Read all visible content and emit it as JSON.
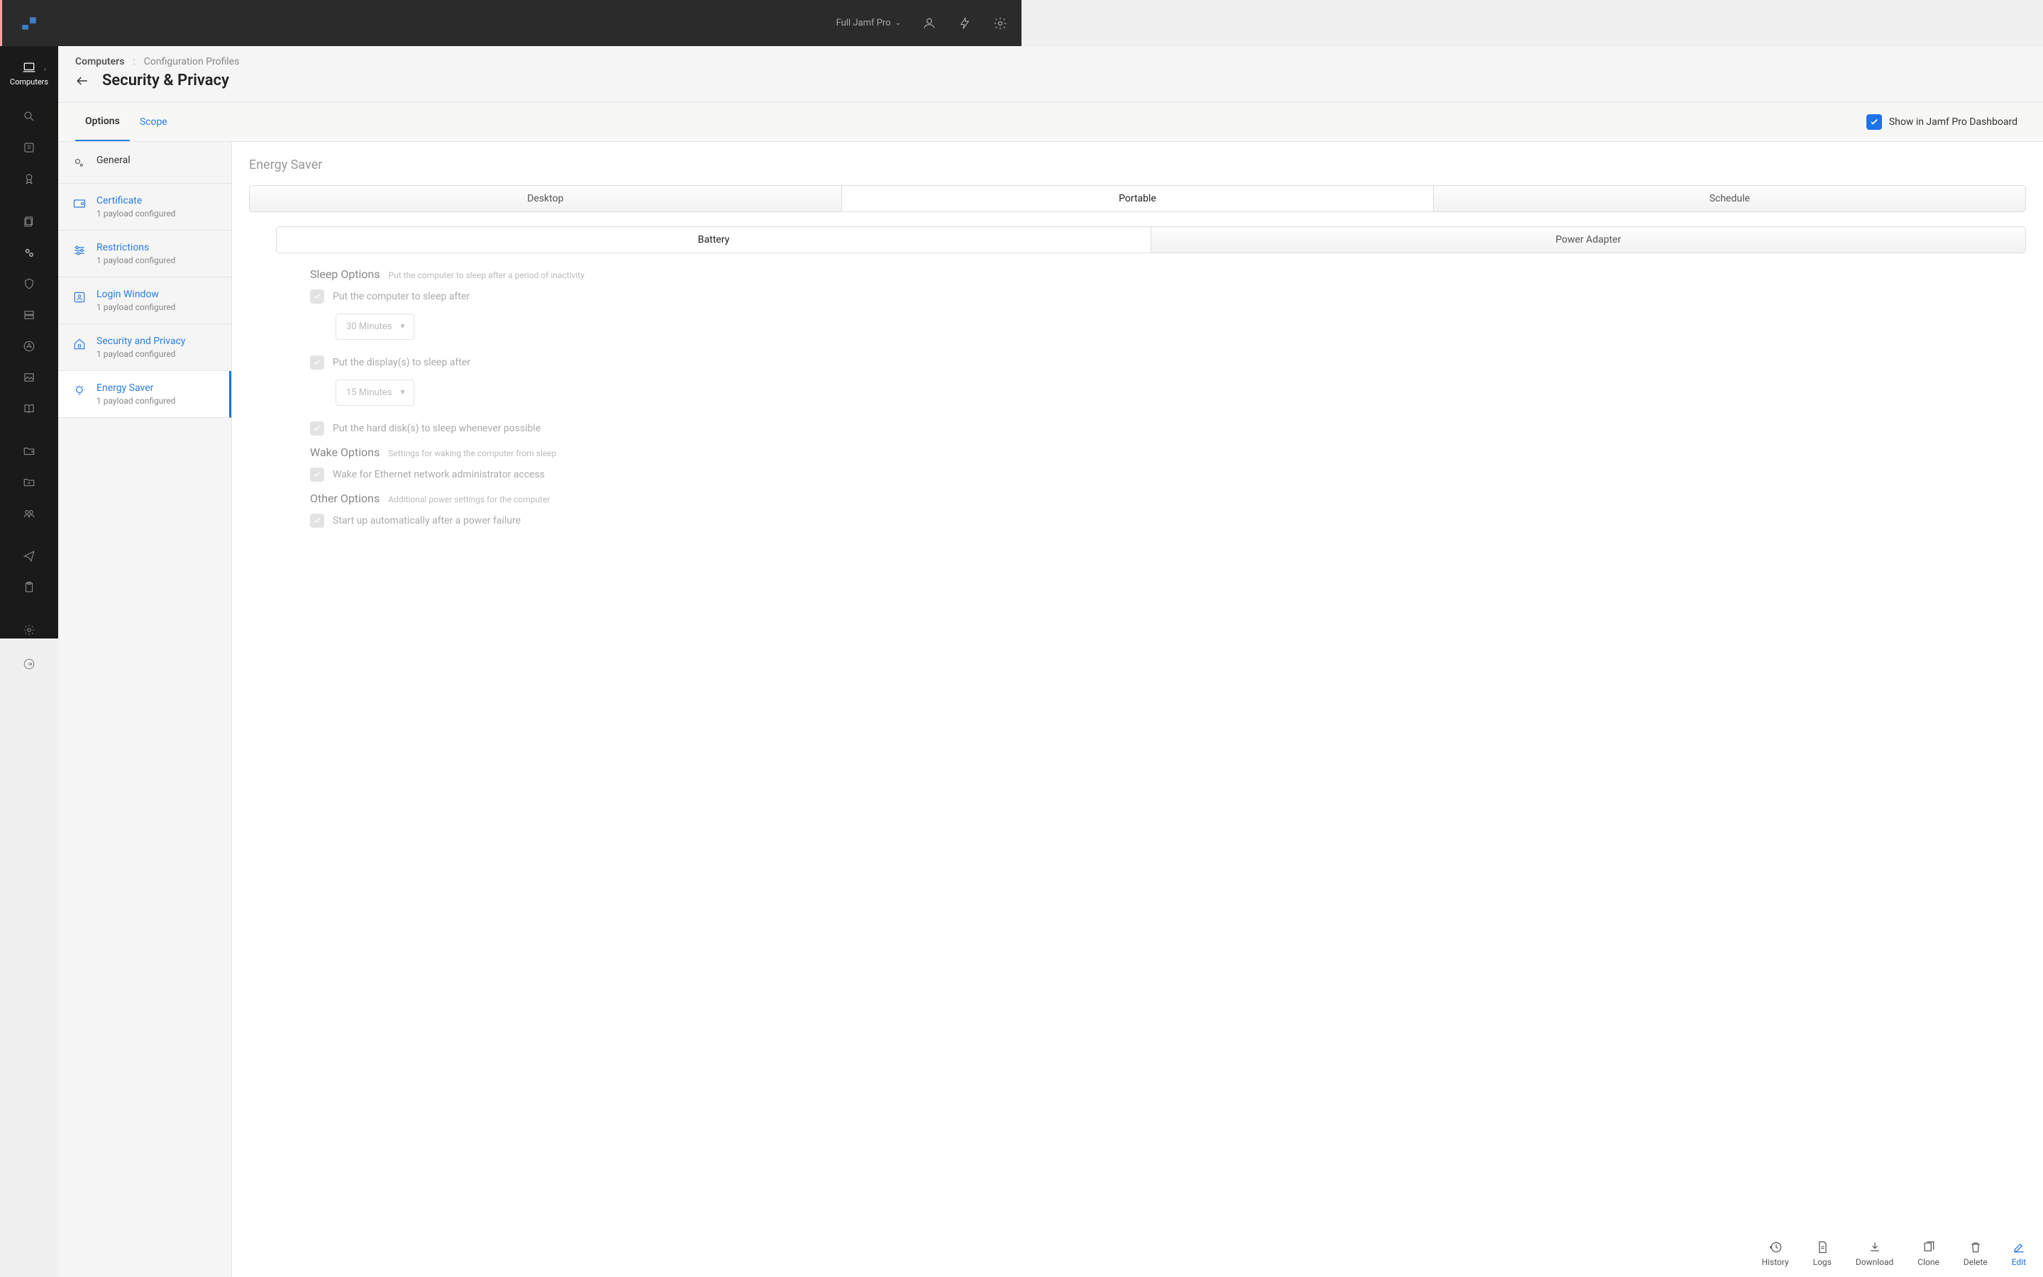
{
  "topbar": {
    "product_label": "Full Jamf Pro"
  },
  "sidebar": {
    "active_label": "Computers"
  },
  "breadcrumb": {
    "root": "Computers",
    "leaf": "Configuration Profiles"
  },
  "page": {
    "title": "Security & Privacy"
  },
  "tabs": {
    "options": "Options",
    "scope": "Scope",
    "dashboard_label": "Show in Jamf Pro Dashboard"
  },
  "payloads": {
    "general": "General",
    "items": [
      {
        "name": "Certificate",
        "sub": "1 payload configured"
      },
      {
        "name": "Restrictions",
        "sub": "1 payload configured"
      },
      {
        "name": "Login Window",
        "sub": "1 payload configured"
      },
      {
        "name": "Security and Privacy",
        "sub": "1 payload configured"
      },
      {
        "name": "Energy Saver",
        "sub": "1 payload configured"
      }
    ]
  },
  "detail": {
    "title": "Energy Saver",
    "segment1": {
      "desktop": "Desktop",
      "portable": "Portable",
      "schedule": "Schedule"
    },
    "segment2": {
      "battery": "Battery",
      "power": "Power Adapter"
    },
    "sleep": {
      "title": "Sleep Options",
      "desc": "Put the computer to sleep after a period of inactivity",
      "opt1": "Put the computer to sleep after",
      "sel1": "30 Minutes",
      "opt2": "Put the display(s) to sleep after",
      "sel2": "15 Minutes",
      "opt3": "Put the hard disk(s) to sleep whenever possible"
    },
    "wake": {
      "title": "Wake Options",
      "desc": "Settings for waking the computer from sleep",
      "opt1": "Wake for Ethernet network administrator access"
    },
    "other": {
      "title": "Other Options",
      "desc": "Additional power settings for the computer",
      "opt1": "Start up automatically after a power failure"
    }
  },
  "footer": {
    "history": "History",
    "logs": "Logs",
    "download": "Download",
    "clone": "Clone",
    "delete": "Delete",
    "edit": "Edit"
  }
}
